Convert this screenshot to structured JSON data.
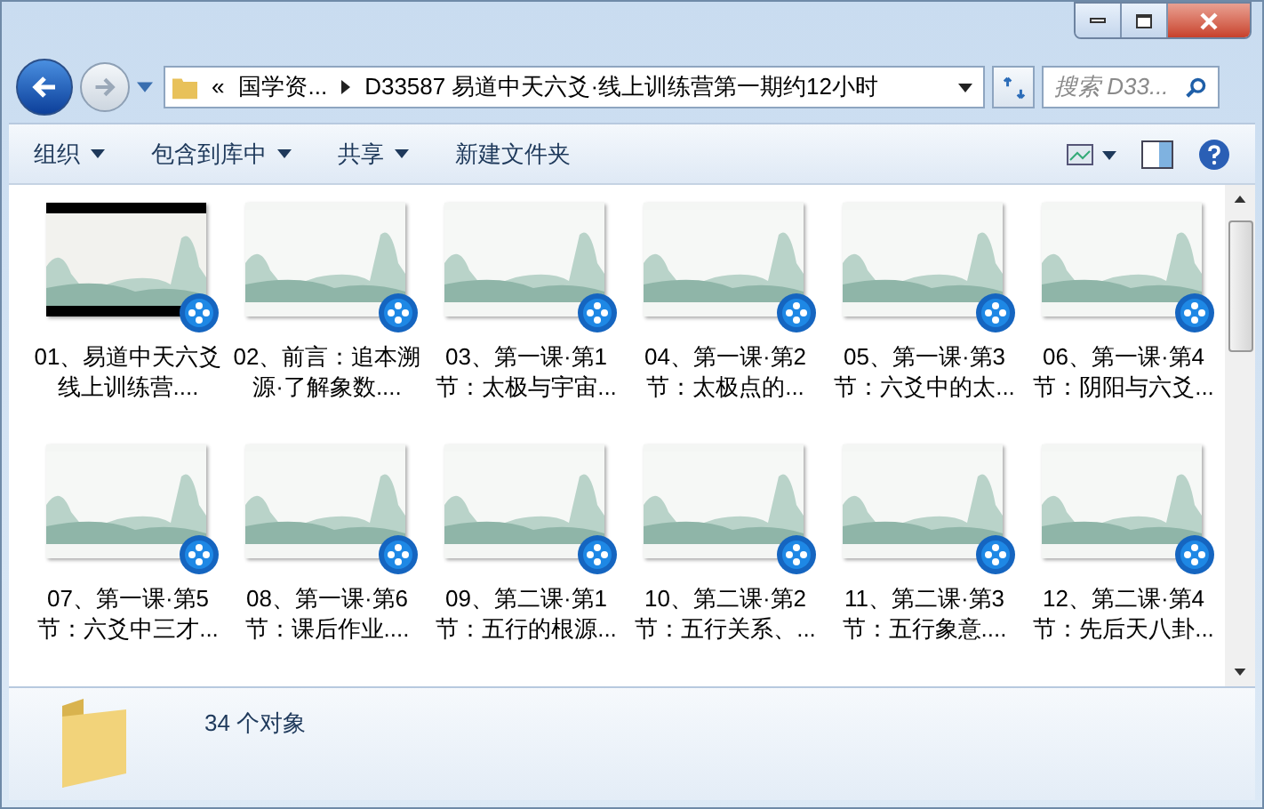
{
  "address_bar": {
    "overflow": "«",
    "crumbs": [
      "国学资...",
      "D33587 易道中天六爻·线上训练营第一期约12小时"
    ]
  },
  "search": {
    "placeholder": "搜索 D33..."
  },
  "toolbar": {
    "items": [
      {
        "label": "组织",
        "dropdown": true
      },
      {
        "label": "包含到库中",
        "dropdown": true
      },
      {
        "label": "共享",
        "dropdown": true
      },
      {
        "label": "新建文件夹",
        "dropdown": false
      }
    ]
  },
  "files": [
    {
      "name": "01、易道中天六爻线上训练营....",
      "kind": "dark"
    },
    {
      "name": "02、前言：追本溯源·了解象数....",
      "kind": "light"
    },
    {
      "name": "03、第一课·第1节：太极与宇宙...",
      "kind": "light"
    },
    {
      "name": "04、第一课·第2节：太极点的...",
      "kind": "light"
    },
    {
      "name": "05、第一课·第3节：六爻中的太...",
      "kind": "light"
    },
    {
      "name": "06、第一课·第4节：阴阳与六爻...",
      "kind": "light"
    },
    {
      "name": "07、第一课·第5节：六爻中三才...",
      "kind": "light"
    },
    {
      "name": "08、第一课·第6节：课后作业....",
      "kind": "light"
    },
    {
      "name": "09、第二课·第1节：五行的根源...",
      "kind": "light"
    },
    {
      "name": "10、第二课·第2节：五行关系、...",
      "kind": "light"
    },
    {
      "name": "11、第二课·第3节：五行象意....",
      "kind": "light"
    },
    {
      "name": "12、第二课·第4节：先后天八卦...",
      "kind": "light"
    }
  ],
  "status": {
    "count": "34 个对象"
  }
}
